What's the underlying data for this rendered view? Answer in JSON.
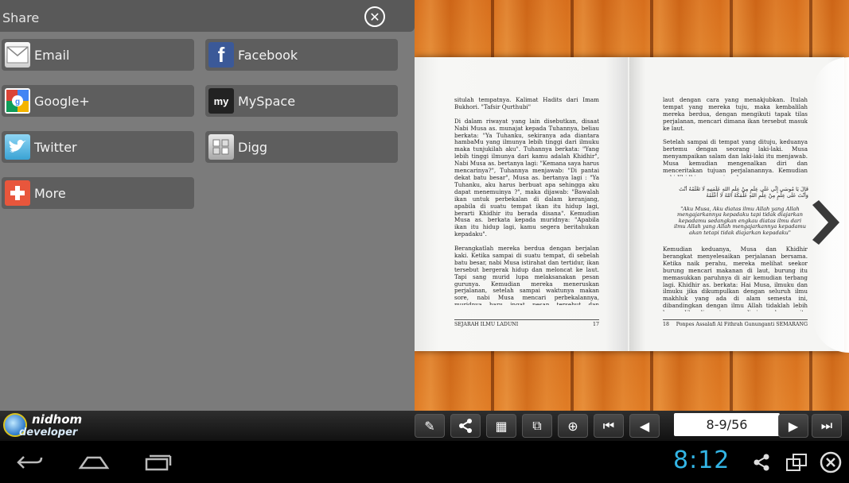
{
  "share": {
    "title": "Share",
    "close_icon": "close-circle-icon",
    "items": [
      {
        "label": "Email",
        "icon": "email-icon"
      },
      {
        "label": "Facebook",
        "icon": "facebook-icon"
      },
      {
        "label": "Google+",
        "icon": "google-plus-icon"
      },
      {
        "label": "MySpace",
        "icon": "myspace-icon"
      },
      {
        "label": "Twitter",
        "icon": "twitter-icon"
      },
      {
        "label": "Digg",
        "icon": "digg-icon"
      },
      {
        "label": "More",
        "icon": "plus-icon"
      }
    ],
    "myspace_glyph": "my",
    "facebook_glyph": "f"
  },
  "book": {
    "left_page": {
      "text": "situlah tempatnya. Kalimat Hadits dari Imam Bukhori. \"Tafsir Qurthubi\"\n\nDi dalam riwayat yang lain disebutkan, disaat Nabi Musa as. munajat kepada Tuhannya, beliau berkata: \"Ya Tuhanku, sekiranya ada diantara hambaMu yang ilmunya lebih tinggi dari ilmuku maka tunjukilah aku\". Tuhannya berkata: \"Yang lebih tinggi ilmunya dari kamu adalah Khidhir\", Nabi Musa as. bertanya lagi: \"Kemana saya harus mencarinya?\", Tuhannya menjawab: \"Di pantai dekat batu besar\", Musa as. bertanya lagi : \"Ya Tuhanku, aku harus berbuat apa sehingga aku dapat menemuinya ?\", maka dijawab: \"Bawalah ikan untuk perbekalan di dalam keranjang, apabila di suatu tempat ikan itu hidup lagi, berarti Khidhir itu berada disana\". Kemudian Musa as. berkata kepada muridnya: \"Apabila ikan itu hidup lagi, kamu segera beritahukan kepadaku\".\n\nBerangkatlah mereka berdua dengan berjalan kaki. Ketika sampai di suatu tempat, di sebelah batu besar, nabi Musa istirahat dan tertidur, ikan tersebut bergerak hidup dan meloncat ke laut. Tapi sang murid lupa melaksanakan pesan gurunya. Kemudian mereka meneruskan perjalanan, setelah sampai waktunya makan sore, nabi Musa mencari perbekalannya, muridnya baru ingat pesan tersebut dan menceritakan kejadian ikan yang hidup lagi dan meloncat masuk ke",
      "footer_left": "SEJARAH ILMU LADUNI",
      "footer_right": "17"
    },
    "right_page": {
      "text_1": "laut dengan cara yang menakjubkan. Itulah tempat yang mereka tuju, maka kembalilah mereka berdua, dengan mengikuti tapak tilas perjalanan, mencari dimana ikan tersebut masuk ke laut.\n\nSetelah sampai di tempat yang dituju, keduanya bertemu dengan seorang laki-laki. Musa menyampaikan salam dan laki-laki itu menjawab. Musa kemudian mengenalkan diri dan menceritakan tujuan perjalanannya. Kemudian nabi Khidhir as. menjawab :",
      "arabic": "قَالَ يَا مُوسَى إِنِّي عَلَى عِلْمٍ مِنْ عِلْمِ اللهِ عَلَّمَنِيهِ لَا تَعْلَمُهُ أَنْتَ وَأَنْتَ عَلَى عِلْمٍ مِنْ عِلْمِ اللهِ عَلَّمَكَهُ اللهُ لَا أَعْلَمُهُ",
      "quote": "\"Aku Musa, Aku diatas ilmu Allah yang Allah mengajarkannya kepadaku tapi tidak diajarkan kepadamu sedangkan engkau diatas ilmu dari ilmu Allah yang Allah mengajarkannya kepadamu akan tetapi tidak diajarkan kepadaku\"",
      "text_2": "Kemudian keduanya, Musa dan Khidhir berangkat menyelesaikan perjalanan bersama. Ketika naik perahu, mereka melihat seekor burung mencari makanan di laut, burung itu memasukkan paruhnya di air kemudian terbang lagi. Khidhir as. berkata: Hai Musa, ilmuku dan ilmuku jika dikumpulkan dengan seluruh ilmu makhluk yang ada di alam semesta ini, dibandingkan dengan ilmu Allah tidaklah lebih besar dibanding air yang diminum burung itu dibanding",
      "footer_left": "18",
      "footer_right": "Ponpes Assalafi Al Fithrah Gununganti SEMARANG"
    },
    "next_arrow_icon": "chevron-right-icon"
  },
  "toolbar": {
    "brand_line1": "nidhom",
    "brand_line2": "developer",
    "buttons": [
      {
        "icon": "bookmark-pin-icon",
        "glyph": "✎"
      },
      {
        "icon": "share-icon",
        "glyph": "⋖"
      },
      {
        "icon": "grid-thumbnails-icon",
        "glyph": "▦"
      },
      {
        "icon": "page-view-icon",
        "glyph": "⧉"
      },
      {
        "icon": "zoom-in-icon",
        "glyph": "⊕"
      },
      {
        "icon": "first-page-icon",
        "glyph": "⏮"
      },
      {
        "icon": "previous-page-icon",
        "glyph": "◀"
      },
      {
        "icon": "next-page-icon",
        "glyph": "▶"
      },
      {
        "icon": "last-page-icon",
        "glyph": "⏭"
      }
    ],
    "page_indicator": "8-9/56"
  },
  "navbar": {
    "back_icon": "back-icon",
    "home_icon": "home-icon",
    "recents_icon": "recent-apps-icon",
    "clock": "8:12",
    "status_icons": [
      "share-icon",
      "screen-rotate-icon",
      "close-circle-icon"
    ]
  },
  "colors": {
    "accent_clock": "#33b5e5",
    "share_panel_bg": "#7b7b7b",
    "share_button_bg": "#5e5e5e",
    "wood": "#d76e1c"
  }
}
